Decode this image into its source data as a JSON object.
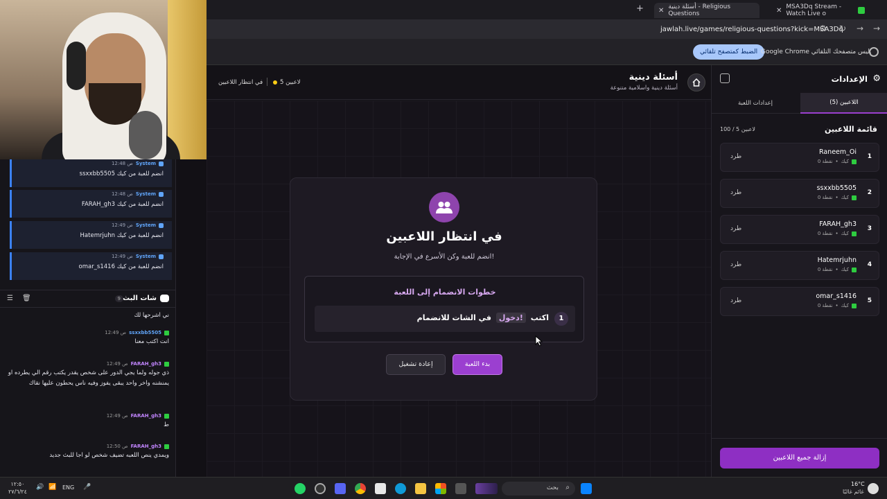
{
  "browser": {
    "tabs": [
      {
        "title": "MSA3Dq Stream - Watch Live o"
      },
      {
        "title": "أسئلة دينية - Religious Questions"
      }
    ],
    "url": "jawlah.live/games/religious-questions?kick=MSA3Dq",
    "infobar_text": "Google Chrome ليس متصفحك التلقائي.",
    "infobar_button": "الضبط كمتصفح تلقائي"
  },
  "chat": {
    "title": "شات البث",
    "count": "9",
    "system_messages": [
      {
        "name": "System",
        "time": "12:48 ص",
        "text": "ssxxbb5505 انضم للعبة من كيك"
      },
      {
        "name": "System",
        "time": "12:48 ص",
        "text": "FARAH_gh3 انضم للعبة من كيك"
      },
      {
        "name": "System",
        "time": "12:49 ص",
        "text": "Hatemrjuhn انضم للعبة من كيك"
      },
      {
        "name": "System",
        "time": "12:49 ص",
        "text": "omar_s1416 انضم للعبة من كيك"
      }
    ],
    "messages": [
      {
        "name": "",
        "time": "",
        "text": "ني اشرحها لك",
        "color": "#ffffff"
      },
      {
        "name": "ssxxbb5505",
        "time": "12:49 ص",
        "text": "انت اكتب معنا",
        "color": "#60a5fa"
      },
      {
        "name": "FARAH_gh3",
        "time": "12:49 ص",
        "text": "ذي جوله ولما يجي الدور على شخص يقدر يكتب رقم الي يطرده او يمنشنه واخر واحد يبقى يفوز وفيه ناس يحطون عليها نقاك",
        "color": "#c084fc"
      },
      {
        "name": "FARAH_gh3",
        "time": "12:49 ص",
        "text": "ط",
        "color": "#c084fc"
      },
      {
        "name": "FARAH_gh3",
        "time": "12:50 ص",
        "text": "ويمدي ينص اللعبه تضيف شخص لو اجا للبث جديد",
        "color": "#c084fc"
      }
    ]
  },
  "game": {
    "title": "أسئلة دينية",
    "subtitle": "أسئلة دينية واسلامية متنوعة",
    "player_count_label": "5 لاعبين",
    "status_label": "في انتظار اللاعبين",
    "wait_title": "في انتظار اللاعبين",
    "wait_subtitle": "انضم للعبة وكن الأسرع في الإجابة!",
    "steps_title": "خطوات الانضمام إلى اللعبة",
    "step_number": "1",
    "step_prefix": "اكتب",
    "step_code": "!دخول",
    "step_suffix": "في الشات للانضمام",
    "start_button": "بدء اللعبة",
    "restart_button": "إعادة تشغيل"
  },
  "sidebar": {
    "title": "الإعدادات",
    "tab_players": "اللاعبين (5)",
    "tab_game_settings": "إعدادات اللعبة",
    "players_heading": "قائمة اللاعبين",
    "players_count": "100 / 5 لاعبين",
    "kick_label": "طرد",
    "remove_all_button": "إزالة جميع اللاعبين",
    "players": [
      {
        "index": "1",
        "name": "Raneem_Oi",
        "platform": "كيك",
        "points": "0 نقطة"
      },
      {
        "index": "2",
        "name": "ssxxbb5505",
        "platform": "كيك",
        "points": "0 نقطة"
      },
      {
        "index": "3",
        "name": "FARAH_gh3",
        "platform": "كيك",
        "points": "0 نقطة"
      },
      {
        "index": "4",
        "name": "Hatemrjuhn",
        "platform": "كيك",
        "points": "0 نقطة"
      },
      {
        "index": "5",
        "name": "omar_s1416",
        "platform": "كيك",
        "points": "0 نقطة"
      }
    ]
  },
  "taskbar": {
    "search_placeholder": "بحث",
    "language": "ENG",
    "time": "١٢:٥٠",
    "date": "٢٧/٦/٢٤",
    "weather_temp": "16°C",
    "weather_text": "غائم غالبًا"
  },
  "colors": {
    "accent_purple": "#9b3fd0",
    "kick_green": "#2ecc40",
    "system_blue": "#3b82f6"
  }
}
